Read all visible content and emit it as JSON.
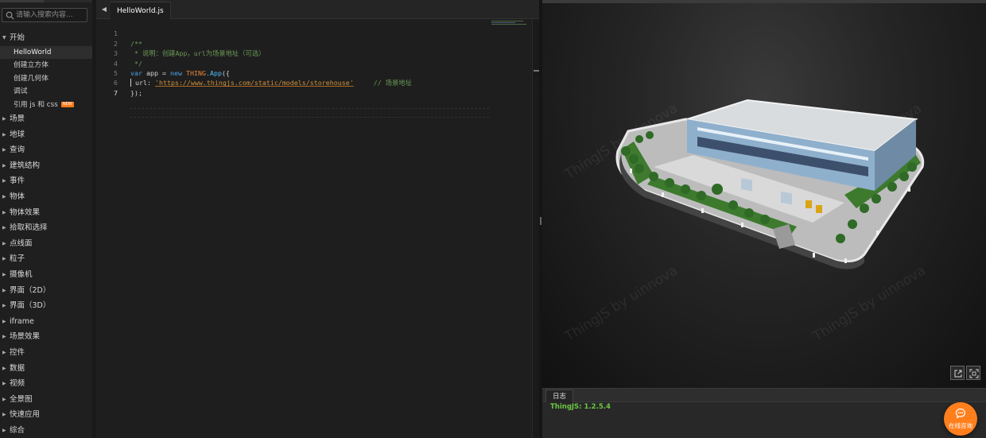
{
  "sidebar": {
    "search_placeholder": "请输入搜索内容...",
    "open_category": {
      "label": "开始",
      "items": [
        {
          "label": "HelloWorld",
          "active": true
        },
        {
          "label": "创建立方体"
        },
        {
          "label": "创建几何体"
        },
        {
          "label": "调试"
        },
        {
          "label": "引用 js 和 css",
          "badge": "NEW"
        }
      ]
    },
    "categories": [
      "场景",
      "地球",
      "查询",
      "建筑结构",
      "事件",
      "物体",
      "物体效果",
      "拾取和选择",
      "点线面",
      "粒子",
      "摄像机",
      "界面（2D）",
      "界面（3D）",
      "iframe",
      "场景效果",
      "控件",
      "数据",
      "视频",
      "全景图",
      "快速应用",
      "综合"
    ]
  },
  "editor": {
    "tab_label": "HelloWorld.js",
    "line_numbers": [
      "1",
      "2",
      "3",
      "4",
      "5",
      "6",
      "7"
    ],
    "code": {
      "l1": "/**",
      "l2": " * 说明：创建App，url为场景地址（可选）",
      "l3": " */",
      "l4_kw1": "var",
      "l4_mid": " app = ",
      "l4_kw2": "new",
      "l4_cls": " THING",
      "l4_fn": ".App",
      "l4_end": "({",
      "l5_key": "    url: ",
      "l5_str": "'https://www.thingjs.com/static/models/storehouse'",
      "l5_comment": "     // 场景地址",
      "l6": "});"
    }
  },
  "preview": {
    "watermark": "ThingJS by uinnova"
  },
  "log": {
    "tab_label": "日志",
    "version_line": "ThingJS: 1.2.5.4"
  },
  "consult": {
    "label": "在线咨询"
  },
  "colors": {
    "accent": "#ff7f1d",
    "log_green": "#6cc644",
    "comment_green": "#6a9955",
    "keyword_blue": "#4fa0e0"
  }
}
